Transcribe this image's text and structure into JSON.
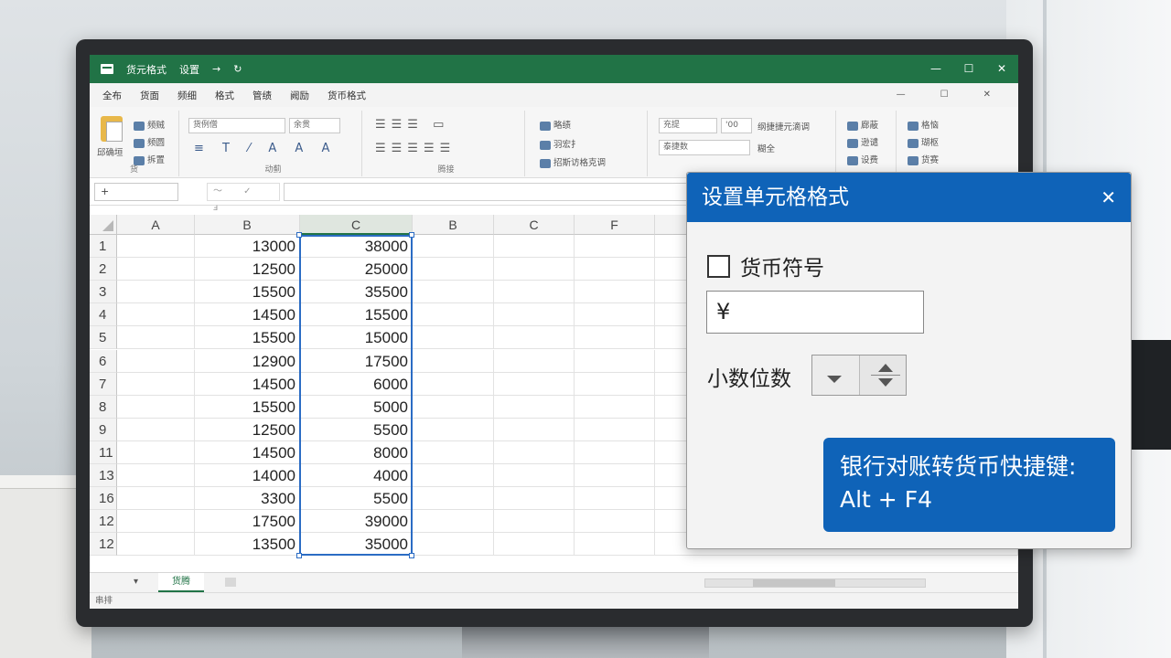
{
  "window": {
    "title": "货元格式",
    "title_items": [
      "设置",
      "→",
      "↻"
    ],
    "controls": [
      "—",
      "☐",
      "✕"
    ]
  },
  "menu": {
    "tabs": [
      "全布",
      "货面",
      "频细",
      "格式",
      "管绩",
      "阙励",
      "货币格式"
    ],
    "controls": [
      "—",
      "☐",
      "✕"
    ]
  },
  "ribbon": {
    "paste_label": "邱确垣",
    "clipboard_items": [
      "频贼",
      "频圆",
      "拆置"
    ],
    "group_labels": [
      "货",
      "动蓟",
      "腾接",
      "",
      ""
    ],
    "font_box": "货例僧",
    "size_box": "余贯",
    "number_box1": "充提",
    "number_box2": "'00",
    "number_box3": "泰捷数",
    "align_items": [
      "略绩",
      "羽宏扌",
      "招斯访格克调"
    ],
    "format_items": [
      "纲捷捷元滴调",
      "糊全"
    ],
    "cells_items": [
      "廊蔽",
      "逊谴",
      "设费"
    ],
    "edit_items": [
      "格恼",
      "瑚枢",
      "货赛"
    ]
  },
  "formula_bar": {
    "name_box": "+",
    "fx_icons": "～ ✓ ⅎ",
    "value": ""
  },
  "grid": {
    "columns": [
      {
        "label": "A",
        "selected": false
      },
      {
        "label": "B",
        "selected": false
      },
      {
        "label": "C",
        "selected": true
      },
      {
        "label": "B",
        "selected": false
      },
      {
        "label": "C",
        "selected": false
      },
      {
        "label": "F",
        "selected": false
      },
      {
        "label": "",
        "selected": false
      }
    ],
    "rows": [
      {
        "n": "1",
        "b": "13000",
        "c": "38000"
      },
      {
        "n": "2",
        "b": "12500",
        "c": "25000"
      },
      {
        "n": "3",
        "b": "15500",
        "c": "35500"
      },
      {
        "n": "4",
        "b": "14500",
        "c": "15500"
      },
      {
        "n": "5",
        "b": "15500",
        "c": "15000"
      },
      {
        "n": "6",
        "b": "12900",
        "c": "17500"
      },
      {
        "n": "7",
        "b": "14500",
        "c": "6000"
      },
      {
        "n": "8",
        "b": "15500",
        "c": "5000"
      },
      {
        "n": "9",
        "b": "12500",
        "c": "5500"
      },
      {
        "n": "11",
        "b": "14500",
        "c": "8000"
      },
      {
        "n": "13",
        "b": "14000",
        "c": "4000"
      },
      {
        "n": "16",
        "b": "3300",
        "c": "5500"
      },
      {
        "n": "12",
        "b": "17500",
        "c": "39000"
      },
      {
        "n": "12",
        "b": "13500",
        "c": "35000"
      }
    ]
  },
  "sheets": {
    "active": "货腾",
    "nav": "▾"
  },
  "status": {
    "text": "串排"
  },
  "dialog": {
    "title": "设置单元格格式",
    "close": "✕",
    "currency_checkbox_label": "货币符号",
    "currency_value": "¥",
    "decimal_label": "小数位数",
    "shortcut_line1": "银行对账转货币快捷键:",
    "shortcut_line2": "Alt + F4"
  },
  "colors": {
    "excel_green": "#217346",
    "dialog_blue": "#0f63b8",
    "selection_blue": "#2b6cc4"
  }
}
